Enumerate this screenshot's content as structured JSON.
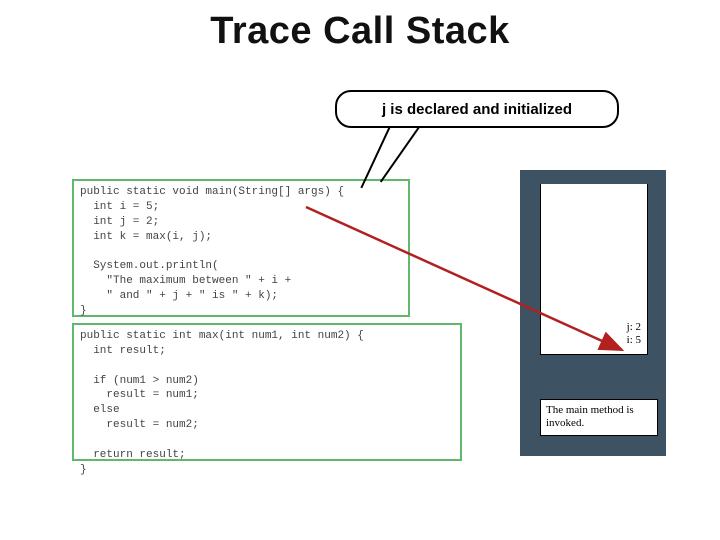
{
  "title": "Trace Call Stack",
  "callout": "j is declared and initialized",
  "code_main": "public static void main(String[] args) {\n  int i = 5;\n  int j = 2;\n  int k = max(i, j);\n\n  System.out.println(\n    \"The maximum between \" + i +\n    \" and \" + j + \" is \" + k);\n}",
  "code_max": "public static int max(int num1, int num2) {\n  int result;\n\n  if (num1 > num2)\n    result = num1;\n  else\n    result = num2;\n\n  return result;\n}",
  "highlight_line_index": 2,
  "stack": {
    "vars": [
      {
        "name": "j",
        "value": "2"
      },
      {
        "name": "i",
        "value": "5"
      }
    ],
    "note": "The main method is invoked."
  },
  "chart_data": {
    "type": "table",
    "title": "Trace Call Stack — step: j is declared and initialized",
    "call_stack": [
      {
        "frame": "main",
        "variables": {
          "i": 5,
          "j": 2
        },
        "current_line": "int j = 2;"
      }
    ],
    "source": {
      "main": [
        "public static void main(String[] args) {",
        "  int i = 5;",
        "  int j = 2;",
        "  int k = max(i, j);",
        "",
        "  System.out.println(",
        "    \"The maximum between \" + i +",
        "    \" and \" + j + \" is \" + k);",
        "}"
      ],
      "max": [
        "public static int max(int num1, int num2) {",
        "  int result;",
        "",
        "  if (num1 > num2)",
        "    result = num1;",
        "  else",
        "    result = num2;",
        "",
        "  return result;",
        "}"
      ]
    }
  }
}
